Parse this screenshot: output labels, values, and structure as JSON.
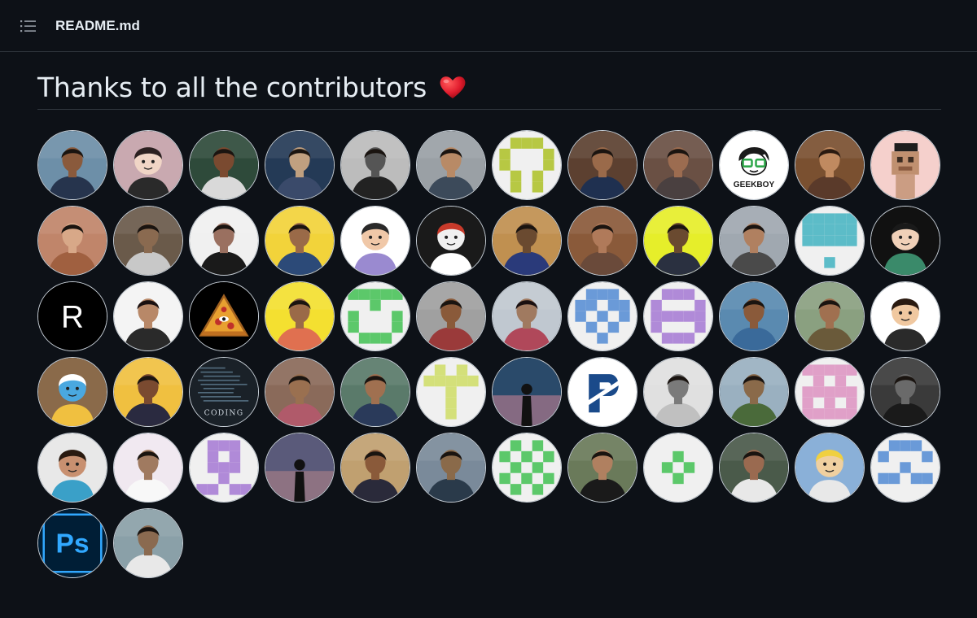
{
  "header": {
    "toc_icon": "list-unordered-icon",
    "filename": "README.md"
  },
  "readme": {
    "heading": "Thanks to all the contributors",
    "heading_emoji": "heart-icon",
    "heart_color": "#e11d2e"
  },
  "contributors": [
    {
      "type": "photo",
      "bg": "#6d8fa8",
      "skin": "#8a5a3c",
      "shirt": "#26344d"
    },
    {
      "type": "cartoon",
      "bg": "#c9a9b0",
      "skin": "#f0d5c6",
      "shirt": "#2a2a2a",
      "hair": "#2b2020"
    },
    {
      "type": "photo",
      "bg": "#2e4a3a",
      "skin": "#7a4a30",
      "shirt": "#d9d9d9"
    },
    {
      "type": "photo",
      "bg": "#243a56",
      "skin": "#c0a080",
      "shirt": "#3a4a6a"
    },
    {
      "type": "photo",
      "bg": "#bcbcbc",
      "skin": "#555555",
      "shirt": "#222222"
    },
    {
      "type": "photo",
      "bg": "#9aa0a5",
      "skin": "#b88a66",
      "shirt": "#3c4a5a"
    },
    {
      "type": "identicon",
      "color": "#b7c843",
      "bg": "#f0f0f0",
      "pattern": [
        0,
        1,
        1,
        1,
        0,
        1,
        0,
        0,
        0,
        1,
        1,
        0,
        0,
        0,
        1,
        0,
        1,
        0,
        1,
        0,
        0,
        1,
        0,
        1,
        0
      ]
    },
    {
      "type": "photo",
      "bg": "#5c4030",
      "skin": "#9a6a4a",
      "shirt": "#1f3050"
    },
    {
      "type": "photo",
      "bg": "#6a5044",
      "skin": "#9c6c50",
      "shirt": "#4a4040"
    },
    {
      "type": "logo",
      "bg": "#ffffff",
      "text": "GEEKBOY",
      "accent": "#2ea84a"
    },
    {
      "type": "photo",
      "bg": "#7a5030",
      "skin": "#c08a60",
      "shirt": "#5a3a2a",
      "hair": "#2a1a10"
    },
    {
      "type": "pixel",
      "bg": "#f5d0cc",
      "skin": "#c09070",
      "hair": "#1e1e1e"
    },
    {
      "type": "photo",
      "bg": "#c0856a",
      "skin": "#d8a888",
      "shirt": "#a06040"
    },
    {
      "type": "photo",
      "bg": "#6a5a4a",
      "skin": "#8a6a50",
      "shirt": "#c8c8c8"
    },
    {
      "type": "photo",
      "bg": "#f0f0f0",
      "skin": "#9a7060",
      "shirt": "#1a1a1a"
    },
    {
      "type": "photo",
      "bg": "#f2d33a",
      "skin": "#9a6a48",
      "shirt": "#2c4a78"
    },
    {
      "type": "cartoon",
      "bg": "#ffffff",
      "skin": "#f0c8a8",
      "shirt": "#9a8ad0",
      "hair": "#2a2a2a"
    },
    {
      "type": "cartoon",
      "bg": "#1a1a1a",
      "skin": "#f0f0f0",
      "shirt": "#ffffff",
      "hair": "#c83a2a"
    },
    {
      "type": "photo",
      "bg": "#c09050",
      "skin": "#6a4a30",
      "shirt": "#2a3a7a"
    },
    {
      "type": "photo",
      "bg": "#8a5a3a",
      "skin": "#b07a5a",
      "shirt": "#6a4a3a"
    },
    {
      "type": "photo",
      "bg": "#e6ee2a",
      "skin": "#6a4a30",
      "shirt": "#2a3040"
    },
    {
      "type": "photo",
      "bg": "#a0a8b0",
      "skin": "#b08060",
      "shirt": "#4a4a4a"
    },
    {
      "type": "identicon",
      "color": "#5cbcc8",
      "bg": "#f0f0f0",
      "pattern": [
        1,
        1,
        1,
        1,
        1,
        1,
        1,
        1,
        1,
        1,
        1,
        1,
        1,
        1,
        1,
        0,
        0,
        0,
        0,
        0,
        0,
        0,
        1,
        0,
        0
      ]
    },
    {
      "type": "cartoon",
      "bg": "#111111",
      "skin": "#f0d0b8",
      "shirt": "#3a8a6a",
      "hair": "#1a1a1a"
    },
    {
      "type": "letter",
      "bg": "#000000",
      "text": "R",
      "color": "#ffffff"
    },
    {
      "type": "photo",
      "bg": "#f4f4f4",
      "skin": "#b88868",
      "shirt": "#2a2a2a",
      "hair": "#1a1010"
    },
    {
      "type": "pizza",
      "bg": "#000000"
    },
    {
      "type": "photo",
      "bg": "#f4e030",
      "skin": "#9a6a48",
      "shirt": "#e07050"
    },
    {
      "type": "identicon",
      "color": "#5cc86a",
      "bg": "#f0f0f0",
      "pattern": [
        1,
        1,
        1,
        1,
        1,
        0,
        0,
        1,
        0,
        0,
        1,
        0,
        0,
        0,
        1,
        1,
        0,
        0,
        0,
        1,
        0,
        1,
        1,
        1,
        0
      ]
    },
    {
      "type": "photo",
      "bg": "#a0a0a0",
      "skin": "#8a5a3a",
      "shirt": "#9a3a3a"
    },
    {
      "type": "photo",
      "bg": "#c0c8d0",
      "skin": "#a07a60",
      "shirt": "#b0485a",
      "hair": "#1a1010"
    },
    {
      "type": "identicon",
      "color": "#6a9ad8",
      "bg": "#f0f0f0",
      "pattern": [
        0,
        1,
        1,
        1,
        0,
        1,
        1,
        0,
        1,
        1,
        1,
        0,
        1,
        0,
        1,
        0,
        1,
        0,
        1,
        0,
        0,
        0,
        1,
        0,
        0
      ]
    },
    {
      "type": "identicon",
      "color": "#b08ad8",
      "bg": "#f0f0f0",
      "pattern": [
        0,
        1,
        1,
        1,
        0,
        1,
        0,
        0,
        0,
        1,
        1,
        1,
        1,
        1,
        1,
        1,
        0,
        0,
        0,
        1,
        0,
        1,
        1,
        1,
        0
      ]
    },
    {
      "type": "photo",
      "bg": "#5a8ab0",
      "skin": "#8a5a3a",
      "shirt": "#3a6a9a"
    },
    {
      "type": "photo",
      "bg": "#8aa080",
      "skin": "#a07050",
      "shirt": "#6a5a3a"
    },
    {
      "type": "cartoon",
      "bg": "#ffffff",
      "skin": "#f0c8a0",
      "shirt": "#2a2a2a",
      "hair": "#2a1a10"
    },
    {
      "type": "cartoon",
      "bg": "#8a6a4a",
      "skin": "#4aa8e0",
      "shirt": "#f0c040",
      "hair": "#ffffff"
    },
    {
      "type": "photo",
      "bg": "#f0c040",
      "skin": "#7a4a30",
      "shirt": "#2a2a40"
    },
    {
      "type": "coding",
      "bg": "#1a2128",
      "text": "CODING"
    },
    {
      "type": "photo",
      "bg": "#8a6a5a",
      "skin": "#9a7050",
      "shirt": "#b05a6a"
    },
    {
      "type": "photo",
      "bg": "#5a7a6a",
      "skin": "#a07050",
      "shirt": "#2a3a5a"
    },
    {
      "type": "identicon",
      "color": "#d4e07a",
      "bg": "#f0f0f0",
      "pattern": [
        0,
        1,
        0,
        1,
        0,
        1,
        1,
        1,
        1,
        1,
        0,
        0,
        1,
        0,
        0,
        0,
        0,
        1,
        0,
        0,
        0,
        0,
        1,
        0,
        0
      ]
    },
    {
      "type": "silhouette",
      "bg": "#2a4a6a",
      "accent": "#e08a9a"
    },
    {
      "type": "logo_p",
      "bg": "#ffffff",
      "color": "#1a4a8a"
    },
    {
      "type": "photo",
      "bg": "#e0e0e0",
      "skin": "#7a7a7a",
      "shirt": "#c0c0c0"
    },
    {
      "type": "photo",
      "bg": "#9ab0c0",
      "skin": "#8a6a4a",
      "shirt": "#4a6a3a"
    },
    {
      "type": "identicon",
      "color": "#e0a0c8",
      "bg": "#f0f0f0",
      "pattern": [
        1,
        1,
        1,
        1,
        1,
        0,
        1,
        0,
        1,
        0,
        1,
        1,
        1,
        1,
        1,
        1,
        0,
        1,
        0,
        1,
        1,
        1,
        1,
        1,
        1
      ]
    },
    {
      "type": "photo",
      "bg": "#3a3a3a",
      "skin": "#6a6a6a",
      "shirt": "#1a1a1a"
    },
    {
      "type": "cartoon",
      "bg": "#e8e8e8",
      "skin": "#c89070",
      "shirt": "#3aa0c8",
      "hair": "#2a1a10"
    },
    {
      "type": "photo",
      "bg": "#f0e8f0",
      "skin": "#a07a60",
      "shirt": "#f8f8f8"
    },
    {
      "type": "identicon",
      "color": "#b08ad8",
      "bg": "#f0f0f0",
      "pattern": [
        0,
        1,
        1,
        1,
        0,
        0,
        1,
        0,
        1,
        0,
        0,
        1,
        1,
        1,
        0,
        0,
        0,
        1,
        0,
        0,
        1,
        1,
        0,
        1,
        1
      ]
    },
    {
      "type": "silhouette",
      "bg": "#5a5a7a",
      "accent": "#c08a8a"
    },
    {
      "type": "photo",
      "bg": "#c0a070",
      "skin": "#8a5a3a",
      "shirt": "#2a2a3a"
    },
    {
      "type": "photo",
      "bg": "#7a8a9a",
      "skin": "#8a6a4a",
      "shirt": "#2a3a4a"
    },
    {
      "type": "identicon",
      "color": "#5cc86a",
      "bg": "#f0f0f0",
      "pattern": [
        0,
        1,
        0,
        1,
        0,
        1,
        0,
        1,
        0,
        1,
        0,
        1,
        0,
        1,
        0,
        1,
        0,
        1,
        0,
        1,
        0,
        1,
        0,
        1,
        0
      ]
    },
    {
      "type": "photo",
      "bg": "#6a7a5a",
      "skin": "#b08060",
      "shirt": "#1a1a1a"
    },
    {
      "type": "identicon",
      "color": "#5cc86a",
      "bg": "#f0f0f0",
      "pattern": [
        0,
        0,
        0,
        0,
        0,
        0,
        0,
        1,
        0,
        0,
        0,
        1,
        0,
        1,
        0,
        0,
        0,
        1,
        0,
        0,
        0,
        0,
        0,
        0,
        0
      ]
    },
    {
      "type": "photo",
      "bg": "#4a5a4a",
      "skin": "#9a6a50",
      "shirt": "#e8e8e8"
    },
    {
      "type": "cartoon",
      "bg": "#8ab0d8",
      "skin": "#f0d0a0",
      "shirt": "#e8e8e8",
      "hair": "#f0d040"
    },
    {
      "type": "identicon",
      "color": "#6a9ad8",
      "bg": "#f0f0f0",
      "pattern": [
        0,
        1,
        1,
        1,
        0,
        1,
        0,
        0,
        0,
        1,
        0,
        0,
        1,
        0,
        0,
        1,
        1,
        0,
        1,
        1,
        0,
        0,
        0,
        0,
        0
      ]
    },
    {
      "type": "ps",
      "bg": "#001e36",
      "text": "Ps",
      "color": "#31a8ff"
    },
    {
      "type": "photo",
      "bg": "#8aa0a8",
      "skin": "#8a6a50",
      "shirt": "#e8e8e8"
    }
  ]
}
